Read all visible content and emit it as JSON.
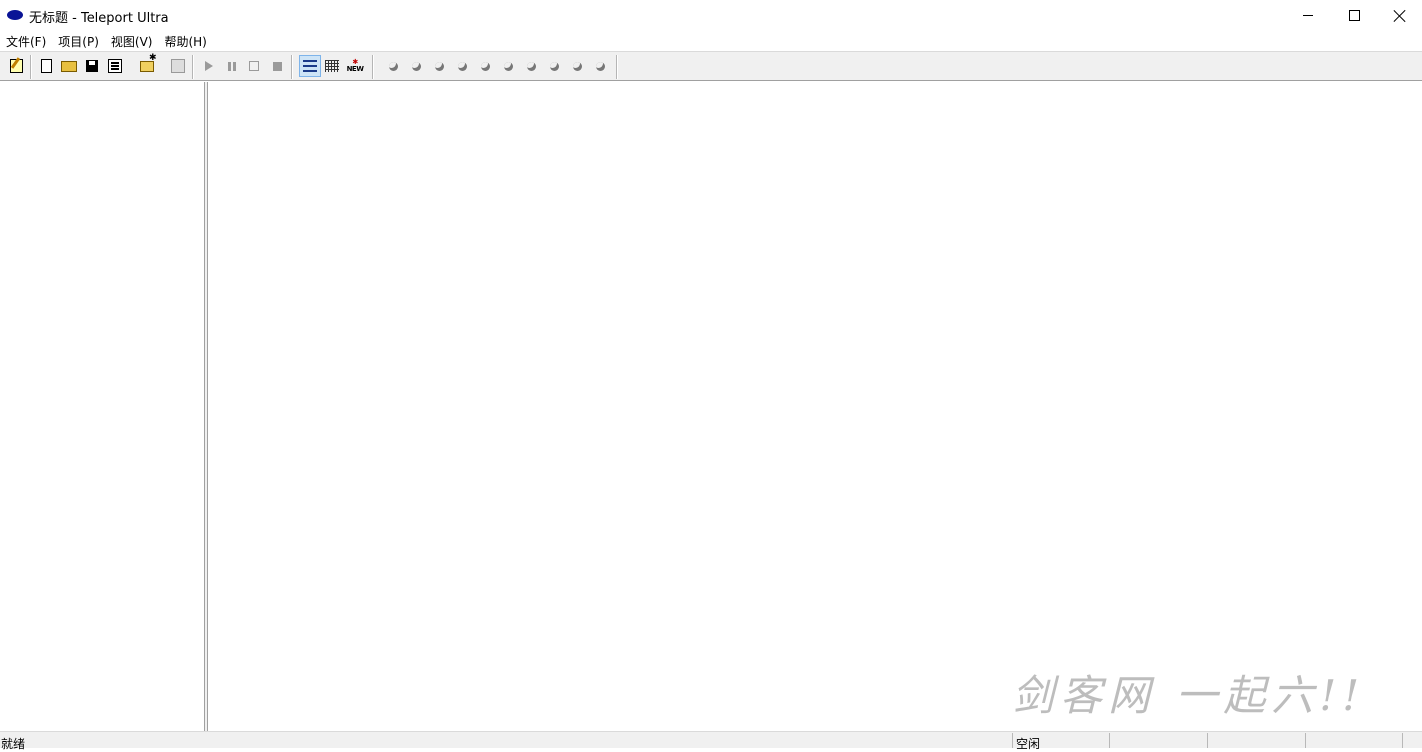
{
  "window": {
    "title": "无标题 - Teleport Ultra"
  },
  "menu": {
    "items": [
      "文件(F)",
      "项目(P)",
      "视图(V)",
      "帮助(H)"
    ]
  },
  "toolbar": {
    "buttons": [
      {
        "name": "edit-project-button",
        "icon": "edit-icon"
      },
      {
        "name": "new-button",
        "icon": "new-document-icon"
      },
      {
        "name": "open-button",
        "icon": "open-folder-icon"
      },
      {
        "name": "save-button",
        "icon": "save-disk-icon"
      },
      {
        "name": "properties-button",
        "icon": "properties-icon"
      },
      {
        "name": "new-address-button",
        "icon": "new-folder-icon"
      },
      {
        "name": "copy-button",
        "icon": "copy-icon"
      },
      {
        "name": "start-button",
        "icon": "play-icon"
      },
      {
        "name": "pause-button",
        "icon": "pause-icon"
      },
      {
        "name": "stop-outline-button",
        "icon": "stop-outline-icon"
      },
      {
        "name": "stop-button",
        "icon": "stop-icon"
      },
      {
        "name": "list-view-button",
        "icon": "list-view-icon",
        "active": true
      },
      {
        "name": "detail-view-button",
        "icon": "grid-view-icon"
      },
      {
        "name": "new-badge-button",
        "icon": "new-badge-icon",
        "label": "NEW"
      }
    ],
    "thread_indicators": 10
  },
  "watermark": {
    "text": "剑客网 一起六!!"
  },
  "status": {
    "left": "就绪",
    "right": "空闲"
  }
}
